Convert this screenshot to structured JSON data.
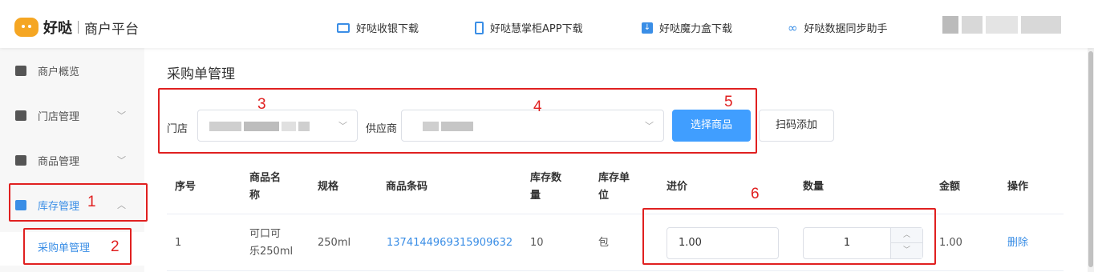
{
  "header": {
    "brand": "好哒",
    "subtitle": "商户平台",
    "links": [
      {
        "label": "好哒收银下载",
        "icon": "monitor-icon"
      },
      {
        "label": "好哒慧掌柜APP下载",
        "icon": "phone-icon"
      },
      {
        "label": "好哒魔力盒下载",
        "icon": "download-icon"
      },
      {
        "label": "好哒数据同步助手",
        "icon": "link-icon"
      }
    ]
  },
  "sidebar": {
    "items": [
      {
        "label": "商户概览",
        "icon": "home-icon"
      },
      {
        "label": "门店管理",
        "icon": "store-icon"
      },
      {
        "label": "商品管理",
        "icon": "goods-icon"
      },
      {
        "label": "库存管理",
        "icon": "cube-icon"
      }
    ],
    "sub_item": "采购单管理"
  },
  "page": {
    "title": "采购单管理",
    "store_label": "门店",
    "supplier_label": "供应商",
    "select_goods_button": "选择商品",
    "scan_add_button": "扫码添加"
  },
  "table": {
    "headers": [
      {
        "line1": "序号",
        "line2": ""
      },
      {
        "line1": "商品名",
        "line2": "称"
      },
      {
        "line1": "规格",
        "line2": ""
      },
      {
        "line1": "商品条码",
        "line2": ""
      },
      {
        "line1": "库存数",
        "line2": "量"
      },
      {
        "line1": "库存单",
        "line2": "位"
      },
      {
        "line1": "进价",
        "line2": ""
      },
      {
        "line1": "数量",
        "line2": ""
      },
      {
        "line1": "金额",
        "line2": ""
      },
      {
        "line1": "操作",
        "line2": ""
      }
    ],
    "row": {
      "index": "1",
      "name_line1": "可口可",
      "name_line2": "乐250ml",
      "spec": "250ml",
      "barcode": "1374144969315909632",
      "stock_qty": "10",
      "stock_unit": "包",
      "price": "1.00",
      "quantity": "1",
      "amount": "1.00",
      "action": "删除"
    }
  },
  "annotations": [
    "1",
    "2",
    "3",
    "4",
    "5",
    "6"
  ],
  "colors": {
    "accent": "#409eff",
    "link": "#3a8ee6",
    "annotation": "#e02020",
    "logo": "#f5a623"
  }
}
